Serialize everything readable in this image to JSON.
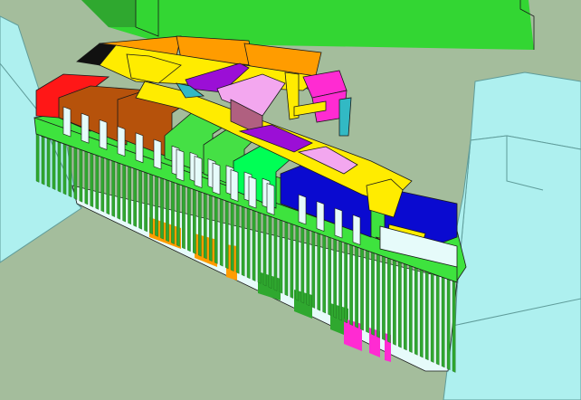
{
  "scene": {
    "kind": "axonometric-massing-model",
    "palette": {
      "ground": "#a4bd9c",
      "neighbor_building": "#aef0ef",
      "neighbor_outline": "#5f9c9a",
      "background_block": "#33d633",
      "facade_fins": "#2fa82f",
      "roof_slab": "#3ee33e",
      "circulation": "#ffec00",
      "unit_red": "#ff1717",
      "unit_brown": "#b6520b",
      "unit_orange": "#ff9c00",
      "unit_green": "#45e045",
      "unit_bright_green": "#00ff55",
      "unit_blue": "#0a0ad0",
      "unit_purple": "#9b0fd6",
      "unit_pink": "#f3a7ef",
      "unit_magenta": "#ff2bd2",
      "unit_mauve": "#b06080",
      "unit_teal": "#32b9c4",
      "outline": "#1a1a1a",
      "glass": "#e6fbfa",
      "black": "#111111"
    }
  }
}
